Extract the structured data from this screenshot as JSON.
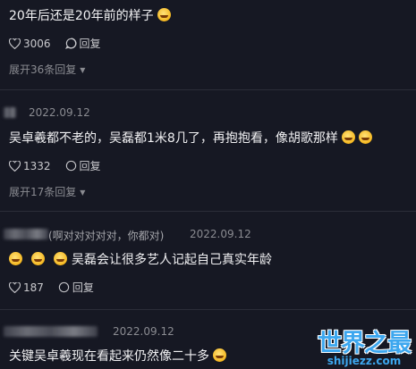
{
  "comments": [
    {
      "text": "20年后还是20年前的样子",
      "likes": "3006",
      "reply_label": "回复",
      "expand_label": "展开36条回复"
    },
    {
      "date": "2022.09.12",
      "text": "吴卓羲都不老的，吴磊都1米8几了，再抱抱看，像胡歌那样",
      "likes": "1332",
      "reply_label": "回复",
      "expand_label": "展开17条回复"
    },
    {
      "username_suffix": "(啊对对对对对，你都对)",
      "date": "2022.09.12",
      "text": "吴磊会让很多艺人记起自己真实年龄",
      "likes": "187",
      "reply_label": "回复"
    },
    {
      "date": "2022.09.12",
      "text": "关键吴卓羲现在看起来仍然像二十多"
    }
  ],
  "watermark": {
    "title": "世界之最",
    "url": "shijiezz.com"
  },
  "colors": {
    "background": "#161823",
    "watermark": "#3da7ef"
  },
  "icons": [
    "heart-icon",
    "reply-icon",
    "emoji-icon"
  ]
}
